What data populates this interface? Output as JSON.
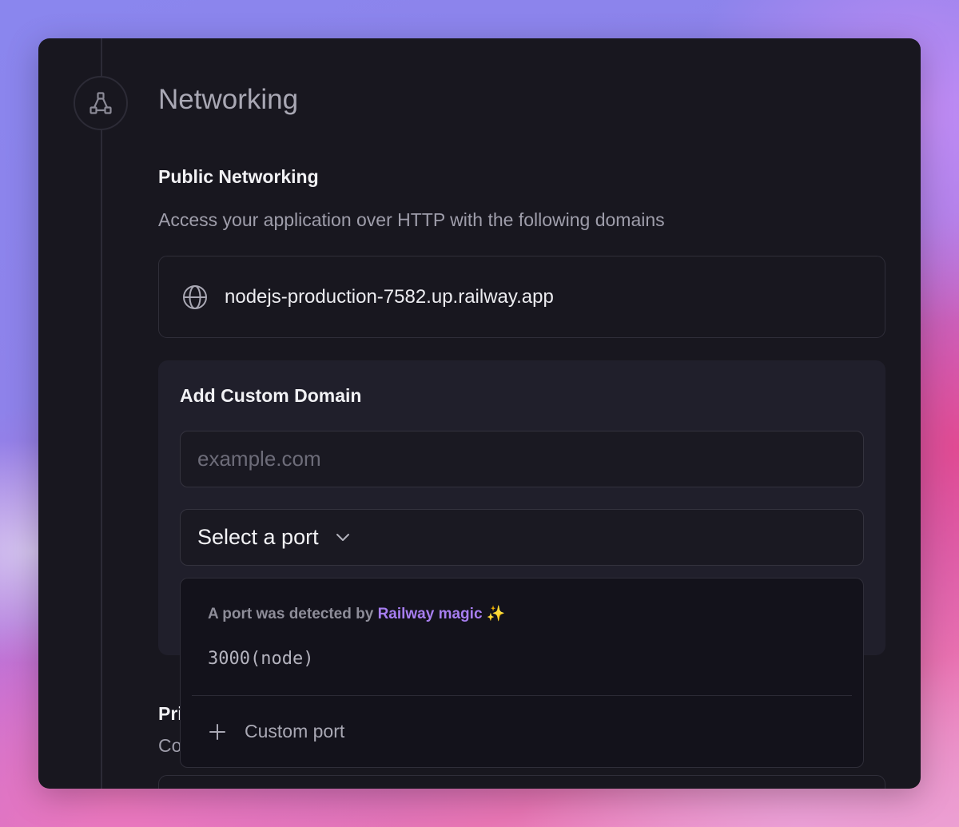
{
  "section": {
    "title": "Networking",
    "icon": "network-nodes-icon"
  },
  "public_networking": {
    "heading": "Public Networking",
    "description": "Access your application over HTTP with the following domains",
    "domain": "nodejs-production-7582.up.railway.app",
    "domain_icon": "globe-icon"
  },
  "custom_domain": {
    "heading": "Add Custom Domain",
    "input_placeholder": "example.com",
    "input_value": "",
    "port_select_label": "Select a port",
    "port_select_icon": "chevron-down-icon"
  },
  "port_dropdown": {
    "detected_prefix": "A port was detected by ",
    "detected_brand": "Railway magic",
    "detected_sparkle": "✨",
    "options": [
      {
        "label": "3000(node)"
      }
    ],
    "custom_port_label": "Custom port",
    "custom_port_icon": "plus-icon"
  },
  "private_networking": {
    "heading_visible": "Pri",
    "description_visible": "Co"
  },
  "colors": {
    "card_bg": "#18171f",
    "panel_bg": "#201f2b",
    "dropdown_bg": "#13121b",
    "accent": "#a77ef0"
  }
}
